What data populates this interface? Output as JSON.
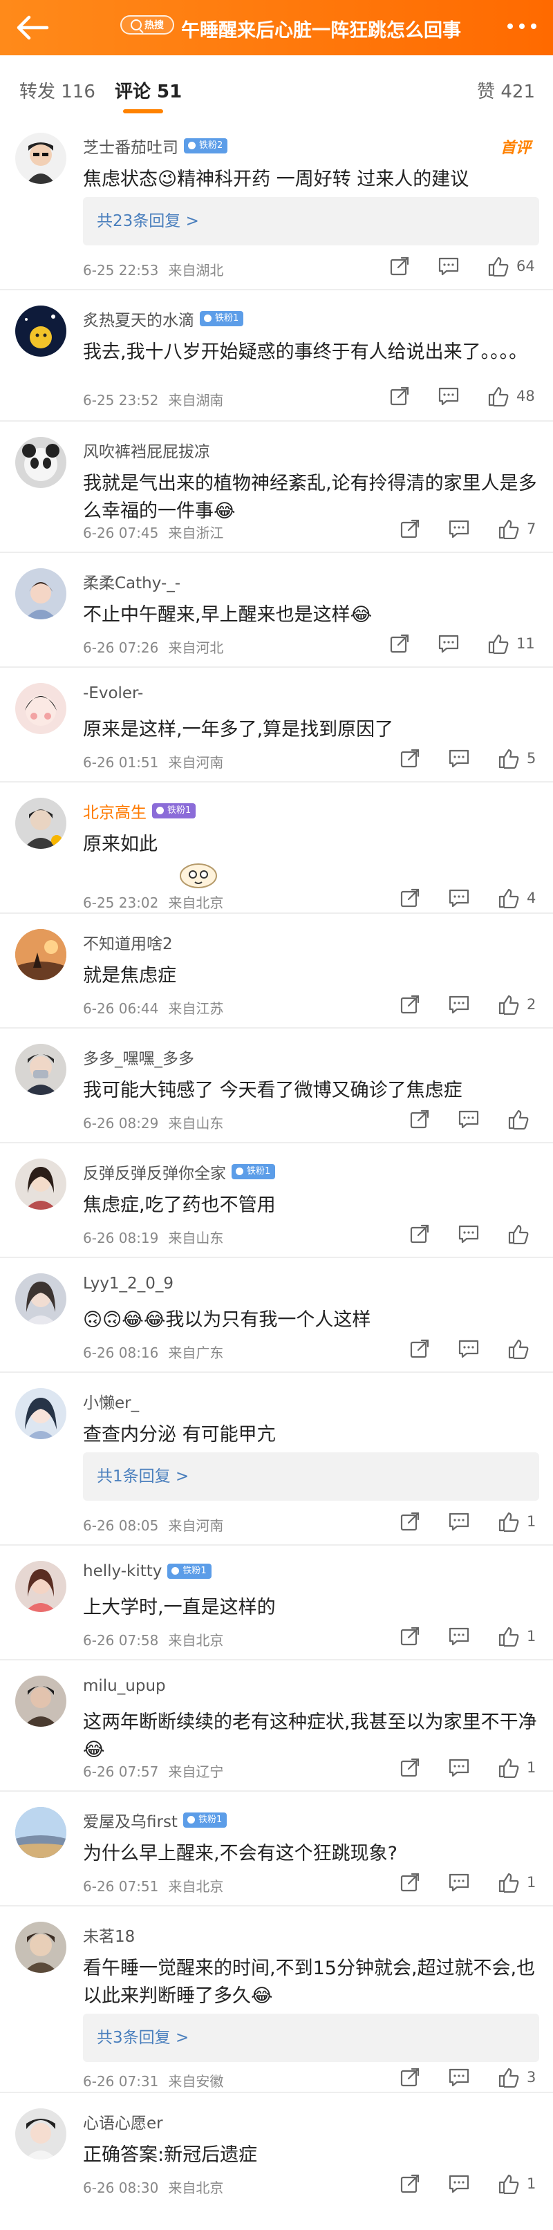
{
  "header": {
    "hot_label": "热搜",
    "title": "午睡醒来后心脏一阵狂跳怎么回事",
    "back_icon": "arrow-left-icon",
    "more_icon": "more-dots-icon",
    "background": "#ff7a00"
  },
  "tabs": {
    "repost": "转发 116",
    "comments": "评论 51",
    "likes": "赞 421"
  },
  "comments": [
    {
      "user": "芝士番茄吐司",
      "badge": "铁粉2",
      "text": "焦虑状态😉精神科开药 一周好转 过来人的建议",
      "chosen": "首评",
      "replies": "共23条回复 >",
      "time": "6-25 22:53",
      "location": "来自湖北",
      "likes": "64"
    },
    {
      "user": "炙热夏天的水滴",
      "badge": "铁粉1",
      "text": "我去,我十八岁开始疑惑的事终于有人给说出来了。。。。",
      "time": "6-25 23:52",
      "location": "来自湖南",
      "likes": "48"
    },
    {
      "user": "风吹裤裆屁屁拔凉",
      "text": "我就是气出来的植物神经紊乱,论有拎得清的家里人是多么幸福的一件事😂",
      "time": "6-26 07:45",
      "location": "来自浙江",
      "likes": "7"
    },
    {
      "user": "柔柔Cathy-_-",
      "text": "不止中午醒来,早上醒来也是这样😂",
      "time": "6-26 07:26",
      "location": "来自河北",
      "likes": "11"
    },
    {
      "user": "-Evoler-",
      "text": "原来是这样,一年多了,算是找到原因了",
      "time": "6-26 01:51",
      "location": "来自河南",
      "likes": "5"
    },
    {
      "user": "北京高生",
      "badge": "铁粉1",
      "text": "原来如此",
      "time": "6-25 23:02",
      "location": "来自北京",
      "likes": "4"
    },
    {
      "user": "不知道用啥2",
      "text": "就是焦虑症",
      "time": "6-26 06:44",
      "location": "来自江苏",
      "likes": "2"
    },
    {
      "user": "多多_嘿嘿_多多",
      "text": "我可能大钝感了 今天看了微博又确诊了焦虑症",
      "time": "6-26 08:29",
      "location": "来自山东",
      "likes": ""
    },
    {
      "user": "反弹反弹反弹你全家",
      "badge": "铁粉1",
      "text": "焦虑症,吃了药也不管用",
      "time": "6-26 08:19",
      "location": "来自山东",
      "likes": ""
    },
    {
      "user": "Lyy1_2_0_9",
      "text": "🙃🙃😂😂我以为只有我一个人这样",
      "time": "6-26 08:16",
      "location": "来自广东",
      "likes": ""
    },
    {
      "user": "小懒er_",
      "text": "查查内分泌 有可能甲亢",
      "replies": "共1条回复 >",
      "time": "6-26 08:05",
      "location": "来自河南",
      "likes": "1"
    },
    {
      "user": "helly-kitty",
      "badge": "铁粉1",
      "text": "上大学时,一直是这样的",
      "time": "6-26 07:58",
      "location": "来自北京",
      "likes": "1"
    },
    {
      "user": "milu_upup",
      "text": "这两年断断续续的老有这种症状,我甚至以为家里不干净😂",
      "time": "6-26 07:57",
      "location": "来自辽宁",
      "likes": "1"
    },
    {
      "user": "爱屋及乌first",
      "badge": "铁粉1",
      "text": "为什么早上醒来,不会有这个狂跳现象?",
      "time": "6-26 07:51",
      "location": "来自北京",
      "likes": "1"
    },
    {
      "user": "未茗18",
      "text": "看午睡一觉醒来的时间,不到15分钟就会,超过就不会,也以此来判断睡了多久😂",
      "replies": "共3条回复 >",
      "time": "6-26 07:31",
      "location": "来自安徽",
      "likes": "3"
    },
    {
      "user": "心语心愿er",
      "text": "正确答案:新冠后遗症",
      "time": "6-26 08:30",
      "location": "来自北京",
      "likes": "1"
    }
  ]
}
